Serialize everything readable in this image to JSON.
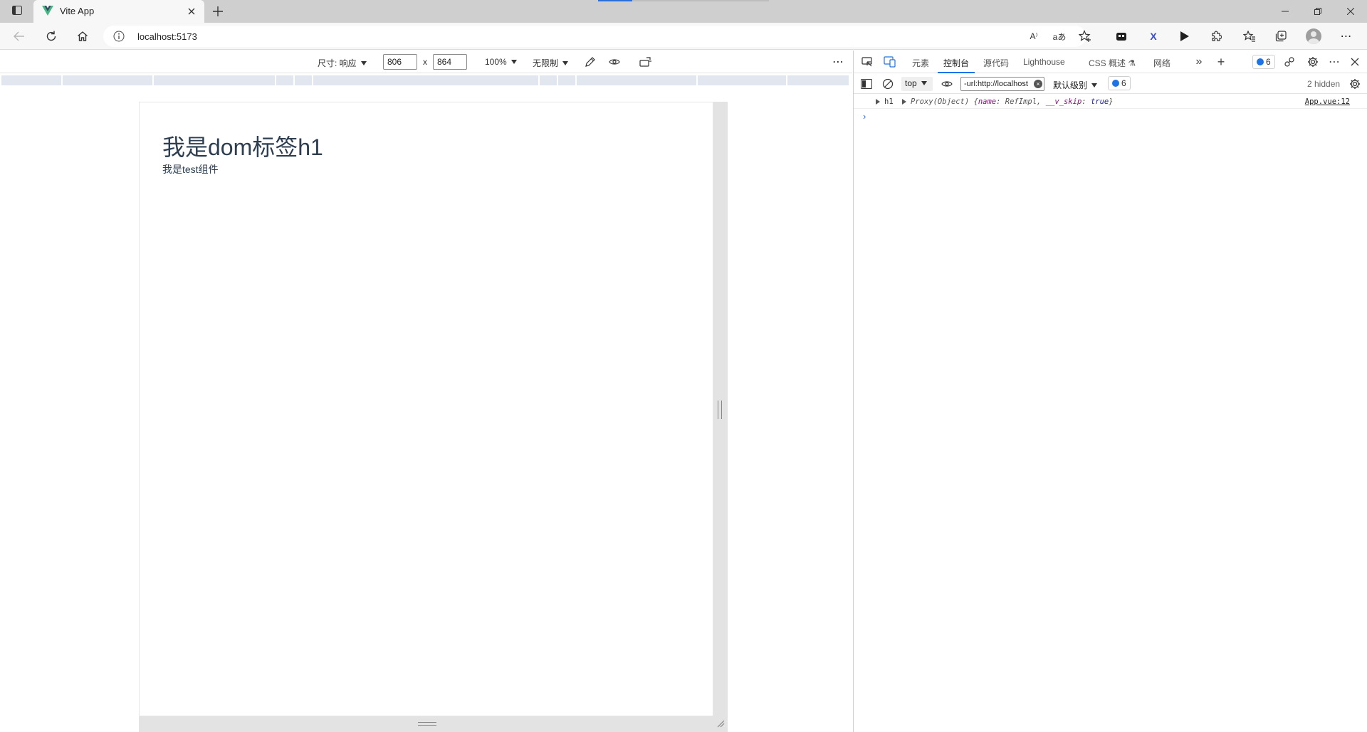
{
  "browser": {
    "tab_title": "Vite App",
    "url": "localhost:5173",
    "omnibox_icons": [
      "read-aloud-icon",
      "translate-icon",
      "add-favorite-icon"
    ],
    "read_aloud_glyph": "A⁾",
    "translate_glyph": "aあ",
    "extension_x_label": "X"
  },
  "device_toolbar": {
    "size_label": "尺寸: 响应",
    "width_value": "806",
    "height_value": "864",
    "times": "x",
    "zoom_label": "100%",
    "throttle_label": "无限制",
    "more": "⋯"
  },
  "page": {
    "heading": "我是dom标签h1",
    "subtext": "我是test组件"
  },
  "devtools": {
    "tabs": [
      {
        "label": "元素"
      },
      {
        "label": "控制台",
        "active": true
      },
      {
        "label": "源代码"
      },
      {
        "label": "Lighthouse"
      },
      {
        "label": "CSS 概述 ⚗"
      },
      {
        "label": "网络"
      }
    ],
    "more_tabs": "»",
    "add_tab": "+",
    "message_count": "6",
    "context": "top",
    "filter_value": "-url:http://localhost",
    "level_label": "默认级别",
    "filter_message_count": "6",
    "hidden_label": "2 hidden",
    "console": {
      "tag": "h1",
      "proxy_prefix": "Proxy(Object) {",
      "k1": "name",
      "v1": "RefImpl",
      "k2": "__v_skip",
      "v2": "true",
      "proxy_suffix": "}",
      "source": "App.vue:12",
      "prompt": "›"
    }
  },
  "colors": {
    "accent": "#1a73e8",
    "heading": "#2c3e50",
    "vue_green": "#41b883",
    "vue_dark": "#35495e"
  }
}
